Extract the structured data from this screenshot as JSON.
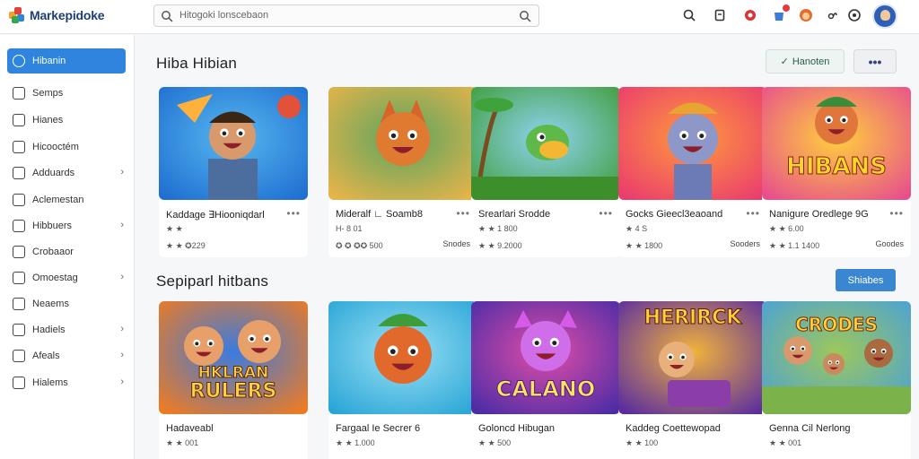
{
  "app": {
    "name": "Markepidoke"
  },
  "search": {
    "text": "Hitogoki lonscebaon"
  },
  "sidebar": {
    "items": [
      {
        "label": "Hibanin",
        "active": true,
        "chevron": false,
        "icon": "home-icon"
      },
      {
        "label": "Semps",
        "chevron": false,
        "icon": "grid-icon"
      },
      {
        "label": "Hianes",
        "chevron": false,
        "icon": "document-icon"
      },
      {
        "label": "Hicooctém",
        "chevron": false,
        "icon": "monitor-icon"
      },
      {
        "label": "Adduards",
        "chevron": true,
        "icon": "user-icon"
      },
      {
        "label": "Aclemestan",
        "chevron": false,
        "icon": "cart-icon"
      },
      {
        "label": "Hibbuers",
        "chevron": true,
        "icon": "settings-icon"
      },
      {
        "label": "Crobaaor",
        "chevron": false,
        "icon": "calendar-icon"
      },
      {
        "label": "Omoestag",
        "chevron": true,
        "icon": "search-icon"
      },
      {
        "label": "Neaems",
        "chevron": false,
        "icon": "mail-icon"
      },
      {
        "label": "Hadiels",
        "chevron": true,
        "icon": "folder-icon"
      },
      {
        "label": "Afeals",
        "chevron": true,
        "icon": "info-icon"
      },
      {
        "label": "Hialems",
        "chevron": true,
        "icon": "cloud-icon"
      }
    ]
  },
  "main": {
    "section1": {
      "title": "Hiba Hibian",
      "btn_action": "Hanoten",
      "btn_more": "•••"
    },
    "section2": {
      "title": "Sepiparl hitbans",
      "btn_blue": "Shiabes"
    },
    "row1": [
      {
        "name": "Kaddage ∃Hiooniqdarl",
        "rating": "★ ★",
        "meta": "★ ★ ✪229",
        "tag": "",
        "art": "man",
        "c1": "#1f6fd1",
        "c2": "#57b7ef"
      },
      {
        "name": "Mideralf ∟ Soamb8",
        "rating": "H‑ 8 01",
        "meta": "✪ ✪ ✪✪ 500",
        "tag": "Snodes",
        "art": "fox",
        "c1": "#e8b44a",
        "c2": "#5aa45f"
      },
      {
        "name": "Srearlari Srodde",
        "rating": "★ ★ 1 800",
        "meta": "★ ★ 9.2000",
        "tag": "",
        "art": "bird",
        "c1": "#3f9e3c",
        "c2": "#8fd3f0"
      },
      {
        "name": "Gocks Gieecl3eaoand",
        "rating": "★ 4 S",
        "meta": "★ ★ 1800",
        "tag": "Sooders",
        "art": "cat",
        "c1": "#ea3c6e",
        "c2": "#ff9a3c"
      },
      {
        "name": "Nanigure Oredlege 9G",
        "rating": "★ ★ 6.00",
        "meta": "★ ★ 1.1 1400",
        "tag": "Goodes",
        "art": "hibans",
        "c1": "#e74f8c",
        "c2": "#ffd03c"
      }
    ],
    "row2": [
      {
        "name": "Hadaveabl",
        "rating": "★ ★ 001",
        "art": "rulers",
        "c1": "#ef7b21",
        "c2": "#3a7be0"
      },
      {
        "name": "Fargaal Ie Secrer 6",
        "rating": "★ ★ 1.000",
        "art": "fox2",
        "c1": "#2aa6d6",
        "c2": "#9be0f5"
      },
      {
        "name": "Goloncd Hibugan",
        "rating": "★ ★ 500",
        "art": "calano",
        "c1": "#4b2ca5",
        "c2": "#e04da8"
      },
      {
        "name": "Kaddeg Coettewopad",
        "rating": "★ ★ 100",
        "art": "herirck",
        "c1": "#5a2ca0",
        "c2": "#f2b43a"
      },
      {
        "name": "Genna Cil Nerlong",
        "rating": "★ ★ 001",
        "art": "crodes",
        "c1": "#4aa1d8",
        "c2": "#9cc85a"
      }
    ],
    "thumb_texts": {
      "hibans": "HIBANS",
      "rulers_1": "HKLRAN",
      "rulers_2": "RULERS",
      "calano": "CALANO",
      "herirck": "HERIRCK",
      "crodes": "CRODES"
    }
  },
  "colors": {
    "accent": "#2f84dd",
    "brand": "#1d3f73",
    "blue_button": "#3a86d0"
  }
}
